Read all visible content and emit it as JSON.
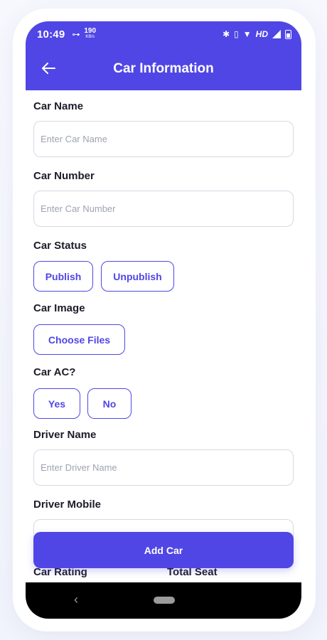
{
  "status_bar": {
    "time": "10:49",
    "speed_value": "190",
    "speed_unit": "KB/s",
    "network_label": "HD"
  },
  "app_bar": {
    "title": "Car Information",
    "back_icon": "arrow-left-icon"
  },
  "form": {
    "car_name": {
      "label": "Car Name",
      "placeholder": "Enter Car Name",
      "value": ""
    },
    "car_number": {
      "label": "Car Number",
      "placeholder": "Enter Car Number",
      "value": ""
    },
    "car_status": {
      "label": "Car Status",
      "options": [
        "Publish",
        "Unpublish"
      ]
    },
    "car_image": {
      "label": "Car Image",
      "button_label": "Choose Files"
    },
    "car_ac": {
      "label": "Car AC?",
      "options": [
        "Yes",
        "No"
      ]
    },
    "driver_name": {
      "label": "Driver Name",
      "placeholder": "Enter Driver Name",
      "value": ""
    },
    "driver_mobile": {
      "label": "Driver Mobile"
    },
    "car_rating": {
      "label": "Car Rating"
    },
    "total_seat": {
      "label": "Total Seat"
    }
  },
  "actions": {
    "add_car_label": "Add Car"
  },
  "colors": {
    "primary": "#5046e5",
    "text": "#1c1c2a",
    "placeholder": "#9ea3b3",
    "border": "#d7d9e3"
  }
}
